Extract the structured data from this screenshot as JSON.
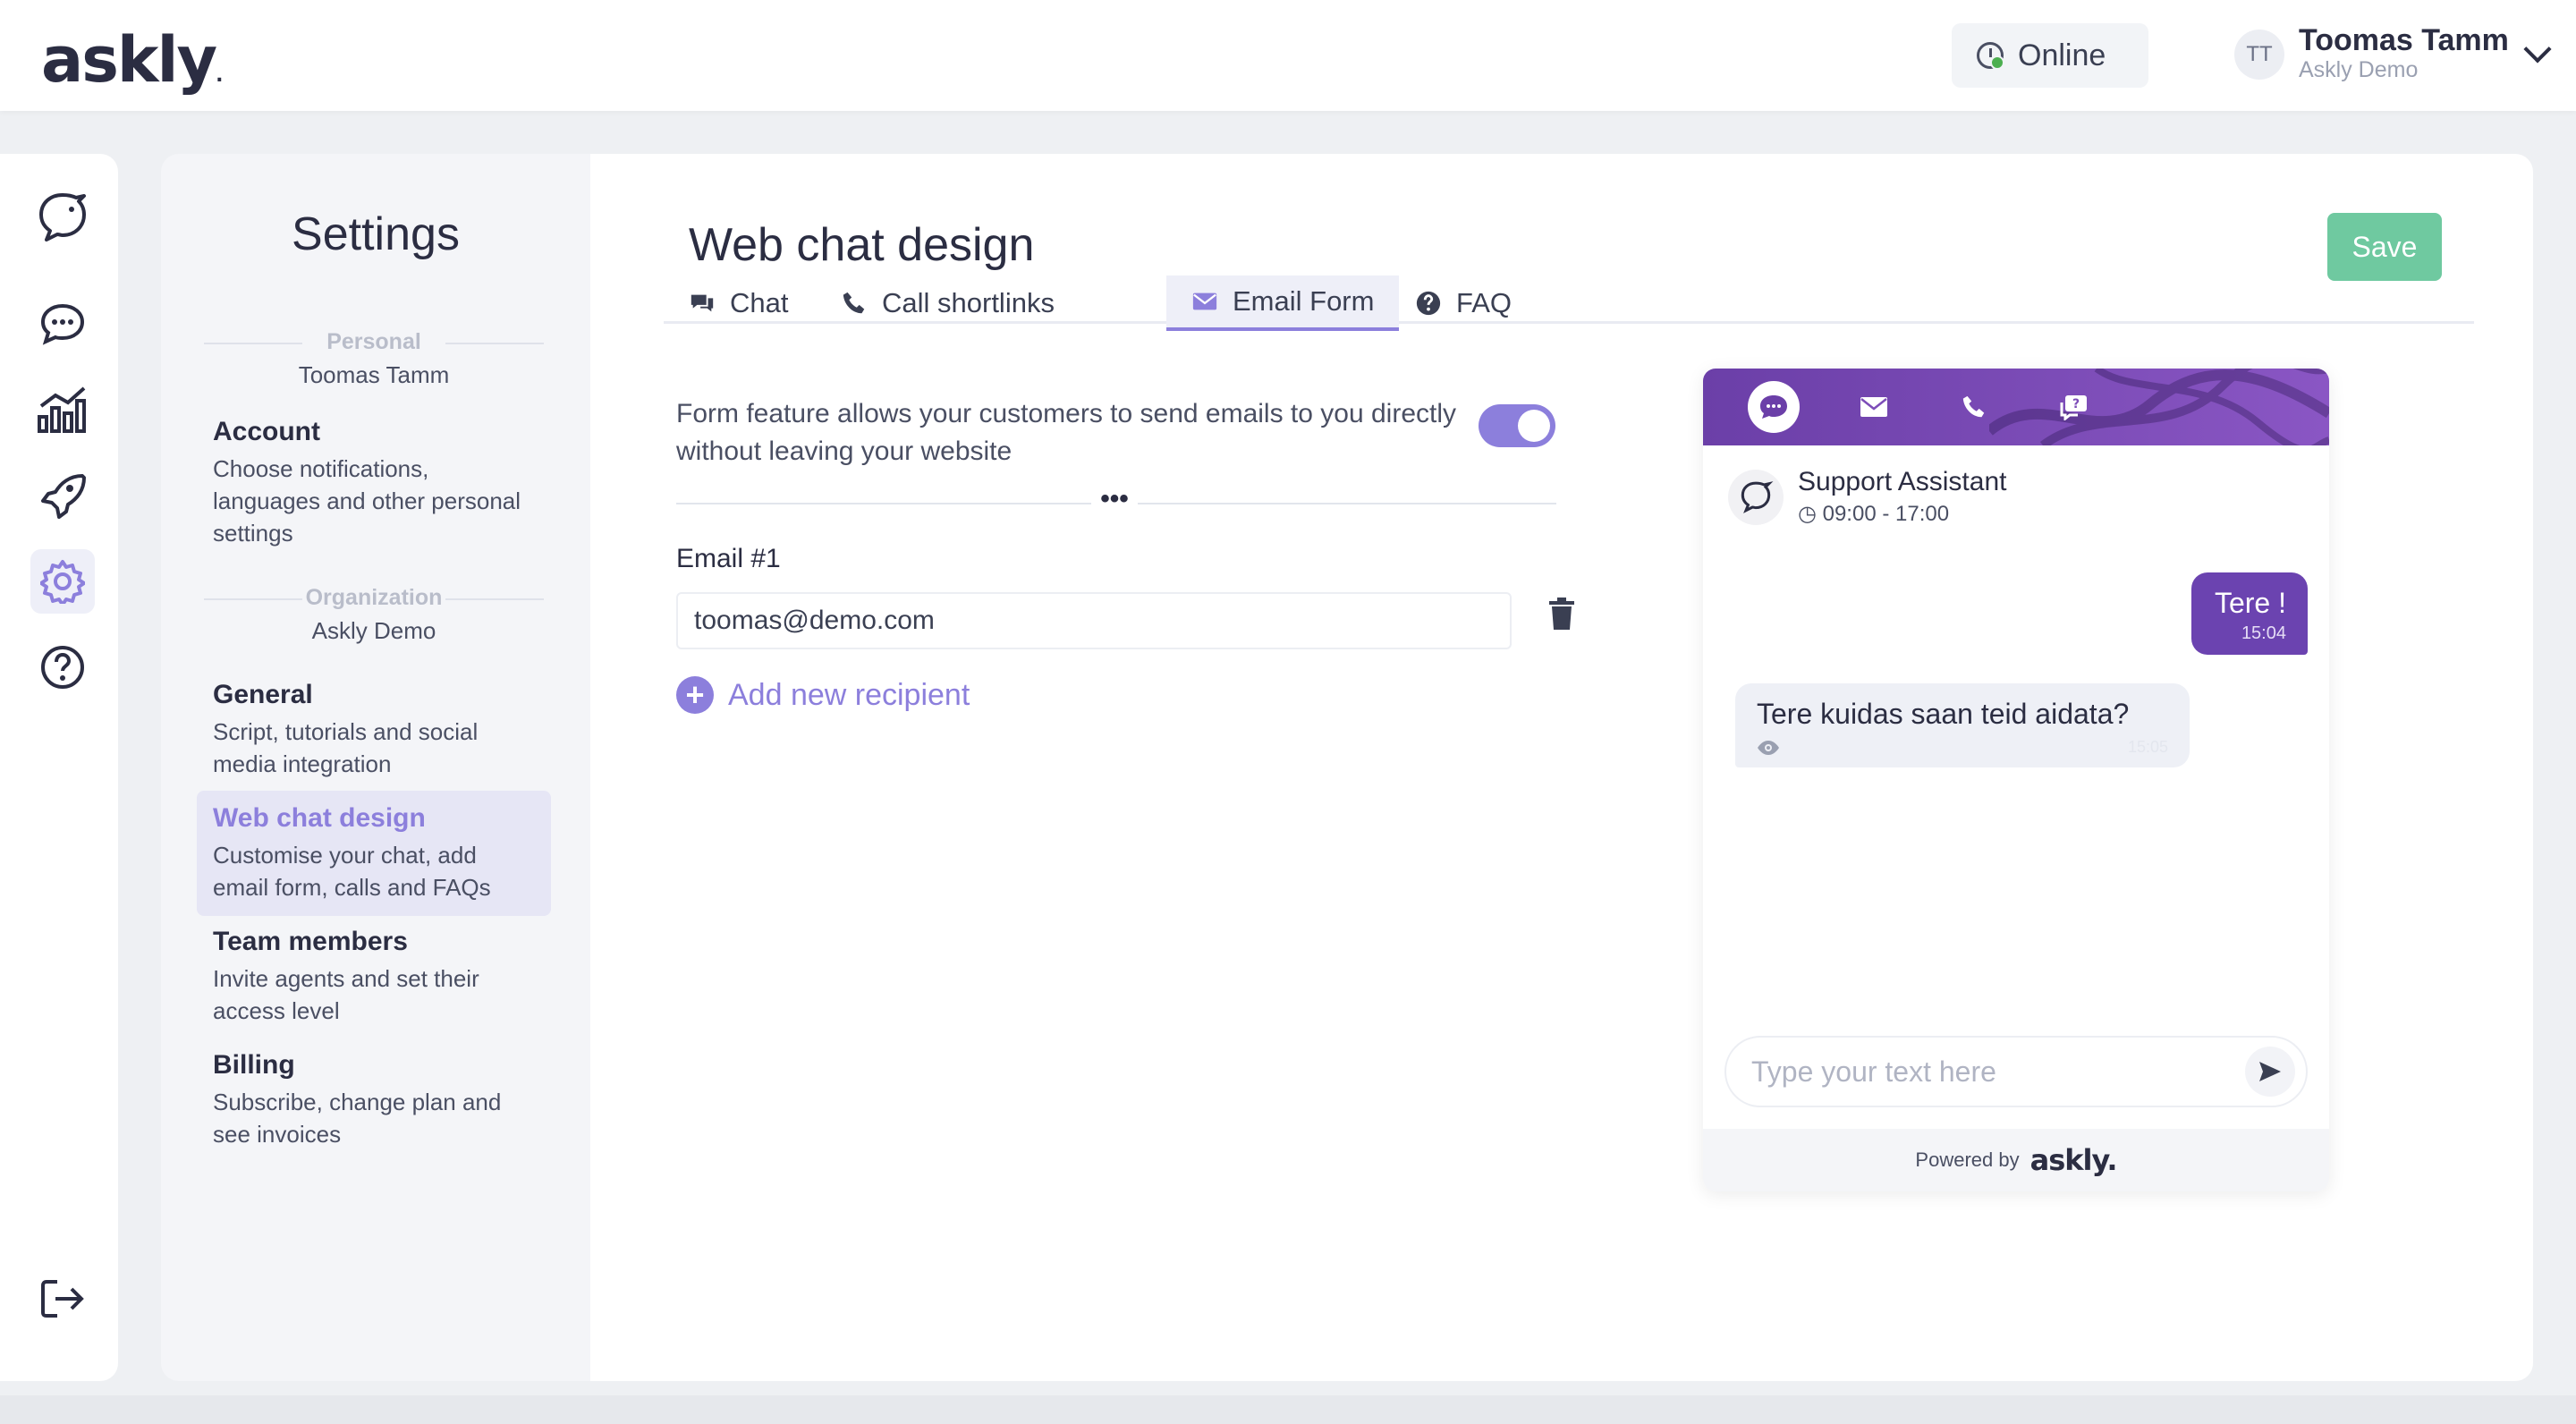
{
  "app": {
    "logo": "askly",
    "logo_dot": "."
  },
  "header": {
    "status_label": "Online",
    "user_initials": "TT",
    "user_name": "Toomas Tamm",
    "user_org": "Askly Demo"
  },
  "rail": {
    "items": [
      "logo-bird-icon",
      "chat-icon",
      "analytics-icon",
      "rocket-icon",
      "settings-gear-icon",
      "help-icon"
    ],
    "active": "settings-gear-icon",
    "logout": "logout-icon"
  },
  "settings": {
    "title": "Settings",
    "personal_label": "Personal",
    "personal_name": "Toomas Tamm",
    "org_label": "Organization",
    "org_name": "Askly Demo",
    "items": [
      {
        "title": "Account",
        "desc": "Choose notifications, languages and other personal settings"
      },
      {
        "title": "General",
        "desc": "Script, tutorials and social media integration"
      },
      {
        "title": "Web chat design",
        "desc": "Customise your chat, add email form, calls and FAQs"
      },
      {
        "title": "Team members",
        "desc": "Invite agents and set their access level"
      },
      {
        "title": "Billing",
        "desc": "Subscribe, change plan and see invoices"
      }
    ],
    "active_item": "Web chat design"
  },
  "main": {
    "title": "Web chat design",
    "save_label": "Save",
    "tabs": [
      {
        "label": "Chat",
        "icon": "chat-bubbles-icon"
      },
      {
        "label": "Call shortlinks",
        "icon": "phone-icon"
      },
      {
        "label": "Email Form",
        "icon": "envelope-icon"
      },
      {
        "label": "FAQ",
        "icon": "question-circle-icon"
      }
    ],
    "active_tab": "Email Form",
    "form_description": "Form feature allows your customers to send emails to you directly without leaving your website",
    "form_enabled": true,
    "divider_glyph": "•••",
    "email_label": "Email #1",
    "email_value": "toomas@demo.com",
    "add_recipient_label": "Add new recipient"
  },
  "preview": {
    "header_icons": [
      "chat-icon",
      "envelope-icon",
      "phone-icon",
      "faq-icon"
    ],
    "active_header_icon": "chat-icon",
    "agent_name": "Support Assistant",
    "agent_hours": "09:00 - 17:00",
    "messages": [
      {
        "direction": "out",
        "text": "Tere !",
        "time": "15:04"
      },
      {
        "direction": "in",
        "text": "Tere kuidas saan teid aidata?",
        "time": "15:05"
      }
    ],
    "input_placeholder": "Type your text here",
    "powered_by": "Powered by",
    "brand": "askly."
  },
  "colors": {
    "accent": "#8c7fdc",
    "save_button": "#6fc9a0",
    "widget_header": "#6b3fa8",
    "outgoing_bubble": "#6b43b0"
  }
}
